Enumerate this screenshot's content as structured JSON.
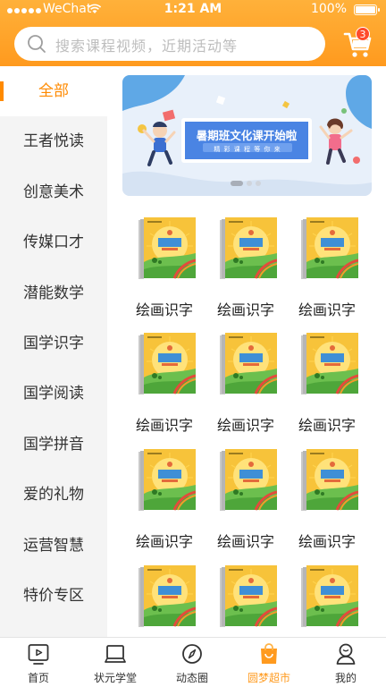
{
  "status_bar": {
    "carrier": "WeChat",
    "time": "1:21 AM",
    "battery": "100%"
  },
  "search": {
    "placeholder": "搜索课程视频，近期活动等"
  },
  "cart": {
    "badge_count": "3"
  },
  "sidebar": {
    "items": [
      {
        "label": "全部",
        "active": true
      },
      {
        "label": "王者悦读",
        "active": false
      },
      {
        "label": "创意美术",
        "active": false
      },
      {
        "label": "传媒口才",
        "active": false
      },
      {
        "label": "潜能数学",
        "active": false
      },
      {
        "label": "国学识字",
        "active": false
      },
      {
        "label": "国学阅读",
        "active": false
      },
      {
        "label": "国学拼音",
        "active": false
      },
      {
        "label": "爱的礼物",
        "active": false
      },
      {
        "label": "运营智慧",
        "active": false
      },
      {
        "label": "特价专区",
        "active": false
      }
    ]
  },
  "banner": {
    "title": "暑期班文化课开始啦",
    "subtitle": "精 彩 课 程 等 你 来",
    "current_page": 1,
    "total_pages": 3
  },
  "products": [
    {
      "name": "绘画识字",
      "book_title": "潜能数学"
    },
    {
      "name": "绘画识字",
      "book_title": "潜能数学"
    },
    {
      "name": "绘画识字",
      "book_title": "潜能数学"
    },
    {
      "name": "绘画识字",
      "book_title": "潜能数学"
    },
    {
      "name": "绘画识字",
      "book_title": "潜能数学"
    },
    {
      "name": "绘画识字",
      "book_title": "潜能数学"
    },
    {
      "name": "绘画识字",
      "book_title": "潜能数学"
    },
    {
      "name": "绘画识字",
      "book_title": "潜能数学"
    },
    {
      "name": "绘画识字",
      "book_title": "潜能数学"
    },
    {
      "name": "绘画识字",
      "book_title": "潜能数学"
    },
    {
      "name": "绘画识字",
      "book_title": "潜能数学"
    },
    {
      "name": "绘画识字",
      "book_title": "潜能数学"
    }
  ],
  "tabbar": {
    "items": [
      {
        "label": "首页",
        "icon": "play-screen-icon",
        "active": false
      },
      {
        "label": "状元学堂",
        "icon": "laptop-icon",
        "active": false
      },
      {
        "label": "动态圈",
        "icon": "compass-icon",
        "active": false
      },
      {
        "label": "圆梦超市",
        "icon": "shopping-bag-icon",
        "active": true
      },
      {
        "label": "我的",
        "icon": "user-icon",
        "active": false
      }
    ]
  },
  "colors": {
    "accent": "#ff9a1e",
    "badge": "#ff4b2b",
    "sidebar_bg": "#f4f4f4"
  }
}
